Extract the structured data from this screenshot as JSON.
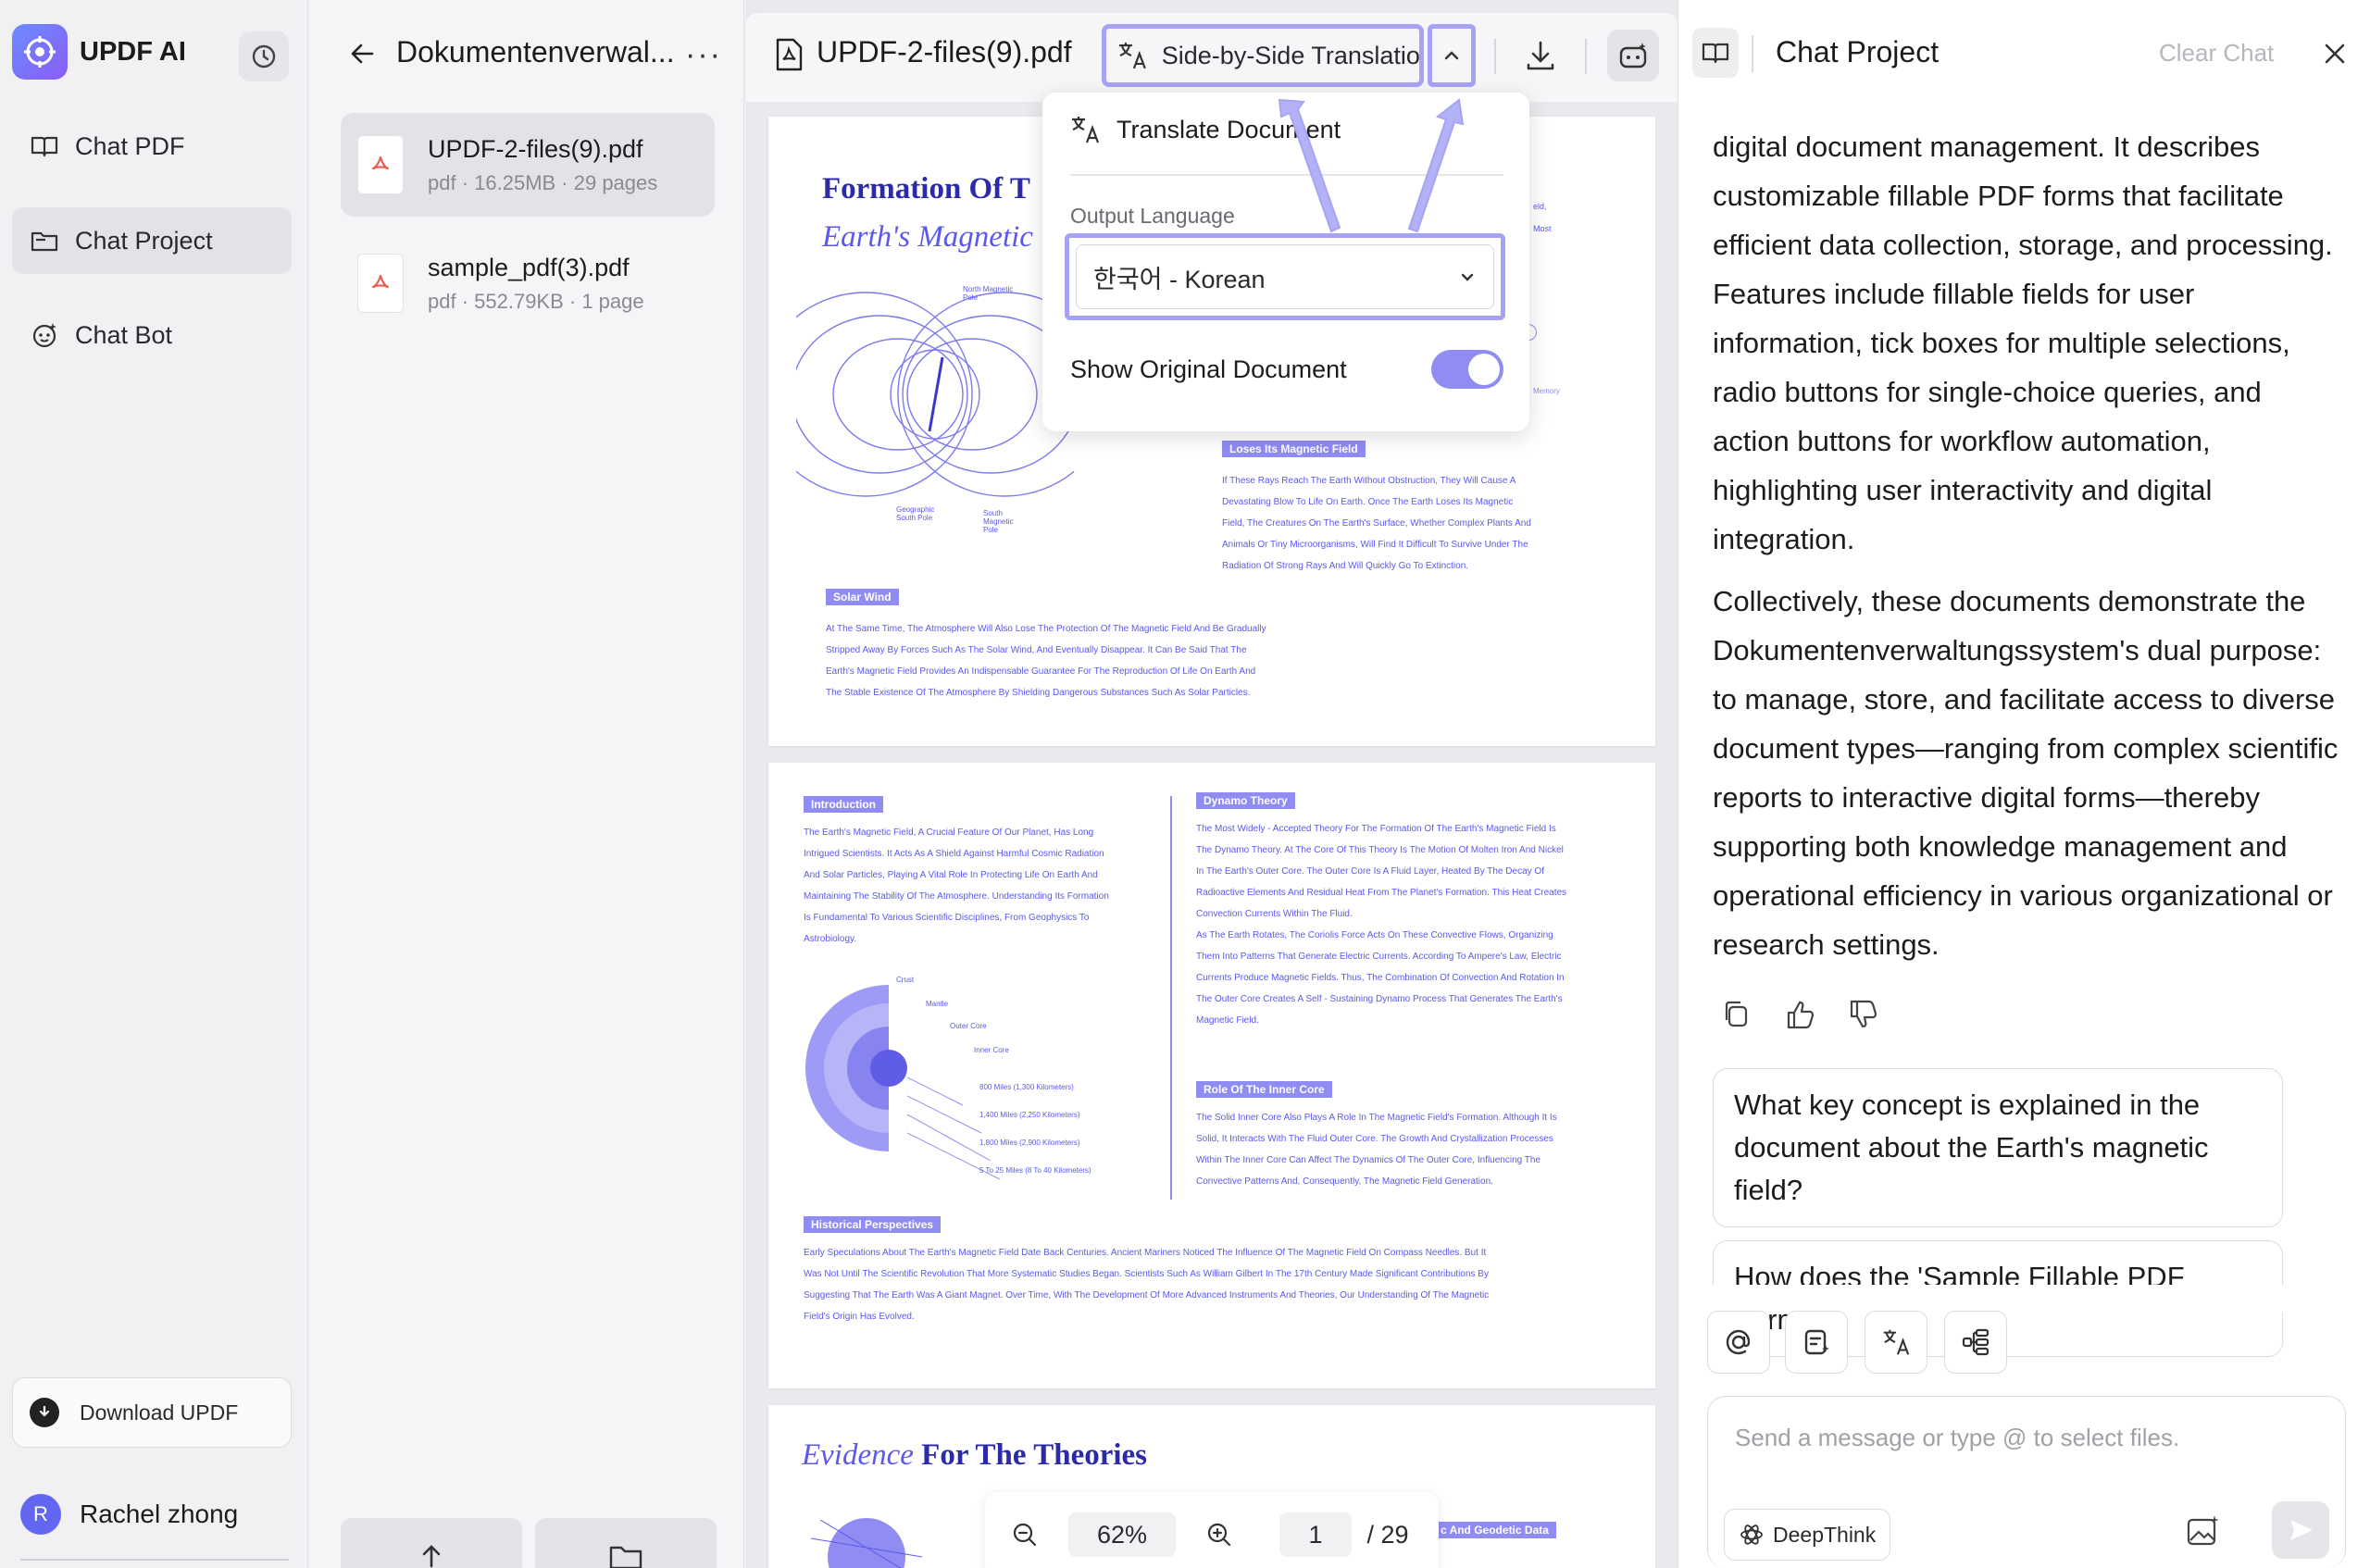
{
  "sidebar": {
    "app_title": "UPDF AI",
    "nav": [
      {
        "label": "Chat PDF"
      },
      {
        "label": "Chat Project"
      },
      {
        "label": "Chat Bot"
      }
    ],
    "download_label": "Download UPDF",
    "user": {
      "initial": "R",
      "name": "Rachel zhong"
    }
  },
  "project": {
    "title": "Dokumentenverwal...",
    "files": [
      {
        "name": "UPDF-2-files(9).pdf",
        "meta": "pdf · 16.25MB · 29 pages"
      },
      {
        "name": "sample_pdf(3).pdf",
        "meta": "pdf · 552.79KB · 1 page"
      }
    ]
  },
  "document": {
    "name": "UPDF-2-files(9).pdf",
    "translation_mode": "Side-by-Side Translation",
    "zoom": "62%",
    "page_current": "1",
    "page_total": "/ 29",
    "page1": {
      "title_a": "Formation Of T",
      "title_b": "Earth's Magnetic",
      "fig_labels": [
        "North Magnetic Pole",
        "Geographic South Pole",
        "South Magnetic Pole"
      ],
      "tag_loses": "Loses Its Magnetic Field",
      "text_loses": [
        "If These Rays Reach The Earth Without Obstruction, They Will Cause A",
        "Devastating Blow To Life On Earth. Once The Earth Loses Its Magnetic",
        "Field, The Creatures On The Earth's Surface, Whether Complex Plants And",
        "Animals Or Tiny Microorganisms, Will Find It Difficult To Survive Under The",
        "Radiation Of Strong Rays And Will Quickly Go To Extinction."
      ],
      "tag_solar": "Solar Wind",
      "text_solar": [
        "At The Same Time, The Atmosphere Will Also Lose The Protection Of The Magnetic Field And Be Gradually",
        "Stripped Away By Forces Such As The Solar Wind, And Eventually Disappear. It Can Be Said That The",
        "Earth's Magnetic Field Provides An Indispensable Guarantee For The Reproduction Of Life On Earth And",
        "The Stable Existence Of The Atmosphere By Shielding Dangerous Substances Such As Solar Particles."
      ],
      "side_a": "eld,",
      "side_b": "Most",
      "side_c": "Memory"
    },
    "page2": {
      "tag_intro": "Introduction",
      "text_intro": [
        "The Earth's Magnetic Field, A Crucial Feature Of Our Planet, Has Long",
        "Intrigued Scientists. It Acts As A Shield Against Harmful Cosmic Radiation",
        "And Solar Particles, Playing A Vital Role In Protecting Life On Earth And",
        "Maintaining The Stability Of The Atmosphere. Understanding Its Formation",
        "Is Fundamental To Various Scientific Disciplines, From Geophysics To",
        "Astrobiology."
      ],
      "layers": [
        "Crust",
        "Mantle",
        "Outer Core",
        "Inner Core"
      ],
      "depths": [
        "800 Miles (1,300 Kilometers)",
        "1,400 Miles (2,250 Kilometers)",
        "1,800 Miles (2,900 Kilometers)",
        "5 To 25 Miles (8 To 40 Kilometers)"
      ],
      "tag_dynamo": "Dynamo Theory",
      "text_dynamo": [
        "The Most Widely - Accepted Theory For The Formation Of The Earth's Magnetic Field Is",
        "The Dynamo Theory. At The Core Of This Theory Is The Motion Of Molten Iron And Nickel",
        "In The Earth's Outer Core. The Outer Core Is A Fluid Layer, Heated By The Decay Of",
        "Radioactive Elements And Residual Heat From The Planet's Formation. This Heat Creates",
        "Convection Currents Within The Fluid.",
        "As The Earth Rotates, The Coriolis Force Acts On These Convective Flows, Organizing",
        "Them Into Patterns That Generate Electric Currents. According To Ampere's Law, Electric",
        "Currents Produce Magnetic Fields. Thus, The Combination Of Convection And Rotation In",
        "The Outer Core Creates A Self - Sustaining Dynamo Process That Generates The Earth's",
        "Magnetic Field."
      ],
      "tag_inner": "Role Of The Inner Core",
      "text_inner": [
        "The Solid Inner Core Also Plays A Role In The Magnetic Field's Formation. Although It Is",
        "Solid, It Interacts With The Fluid Outer Core. The Growth And Crystallization Processes",
        "Within The Inner Core Can Affect The Dynamics Of The Outer Core, Influencing The",
        "Convective Patterns And, Consequently, The Magnetic Field Generation."
      ],
      "tag_hist": "Historical Perspectives",
      "text_hist": [
        "Early Speculations About The Earth's Magnetic Field Date Back Centuries. Ancient Mariners Noticed The Influence Of The Magnetic Field On Compass Needles. But It",
        "Was Not Until The Scientific Revolution That More Systematic Studies Began. Scientists Such As William Gilbert In The 17th Century Made Significant Contributions By",
        "Suggesting That The Earth Was A Giant Magnet. Over Time, With The Development Of More Advanced Instruments And Theories, Our Understanding Of The Magnetic",
        "Field's Origin Has Evolved."
      ]
    },
    "page3": {
      "title_a": "Evidence",
      "title_b": "For The Theories",
      "tag_partial": "c And Geodetic Data"
    }
  },
  "translate_popup": {
    "translate_label": "Translate Document",
    "output_language_label": "Output Language",
    "language_value": "한국어 - Korean",
    "show_original_label": "Show Original Document",
    "show_original_on": true
  },
  "chat": {
    "title": "Chat Project",
    "clear_label": "Clear Chat",
    "message_paragraphs": [
      "digital document management. It describes customizable fillable PDF forms that facilitate efficient data collection, storage, and processing. Features include fillable fields for user information, tick boxes for multiple selections, radio buttons for single-choice queries, and action buttons for workflow automation, highlighting user interactivity and digital integration.",
      "Collectively, these documents demonstrate the Dokumentenverwaltungssystem's dual purpose: to manage, store, and facilitate access to diverse document types—ranging from complex scientific reports to interactive digital forms—thereby supporting both knowledge management and operational efficiency in various organizational or research settings."
    ],
    "suggestions": [
      "What key concept is explained in the document about the Earth's magnetic field?",
      "How does the 'Sample Fillable PDF Form'"
    ],
    "input_placeholder": "Send a message or type @ to select files.",
    "deepthink_label": "DeepThink"
  },
  "colors": {
    "accent": "#8f8cf2",
    "highlight": "#a6a3f5",
    "doc_text": "#5b58f0",
    "title_navy": "#2b2aa8"
  }
}
